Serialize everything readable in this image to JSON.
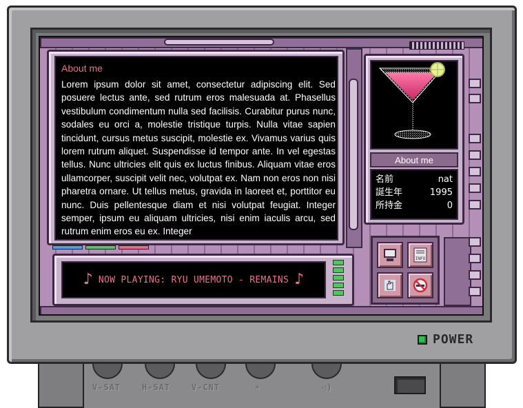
{
  "about_panel": {
    "title": "About me",
    "body": "Lorem ipsum dolor sit amet, consectetur adipiscing elit. Sed posuere lectus ante, sed rutrum eros malesuada at. Phasellus vestibulum condimentum nulla sed facilisis. Curabitur purus nunc, sodales eu orci a, molestie tristique turpis. Nulla vitae sapien tincidunt, cursus metus suscipit, molestie ex. Vivamus varius quis lorem rutrum aliquet. Suspendisse id tempor ante. In vel egestas tellus. Nunc ultricies elit quis ex luctus finibus. Aliquam vitae eros ullamcorper, suscipit velit nec, volutpat ex. Nam non eros non nisi pharetra ornare. Ut tellus metus, gravida in laoreet et, porttitor eu nunc. Duis pellentesque diam et nisi volutpat feugiat. Integer semper, ipsum eu aliquam ultricies, nisi enim iaculis arcu, sed rutrum enim eros eu ex. Integer"
  },
  "now_playing": {
    "note": "♪",
    "text": "NOW PLAYING: RYU UMEMOTO - REMAINS"
  },
  "profile": {
    "header": "About me",
    "avatar_icon": "cocktail-glass-icon",
    "stats": [
      {
        "label": "名前",
        "value": "nat"
      },
      {
        "label": "誕生年",
        "value": "1995"
      },
      {
        "label": "所持金",
        "value": "0"
      }
    ]
  },
  "icon_buttons": [
    {
      "name": "computer-icon"
    },
    {
      "name": "info-icon",
      "label": "INFO"
    },
    {
      "name": "hand-icon"
    },
    {
      "name": "no-smoking-icon"
    }
  ],
  "tabs": [
    {
      "color": "#4aa0e0"
    },
    {
      "color": "#5cc06a"
    },
    {
      "color": "#e86a8a"
    }
  ],
  "monitor": {
    "power_label": "POWER",
    "power_led_color": "#2ec04a",
    "knobs": [
      "V-SAT",
      "H-SAT",
      "V-CNT",
      "☀",
      "◁)"
    ]
  }
}
